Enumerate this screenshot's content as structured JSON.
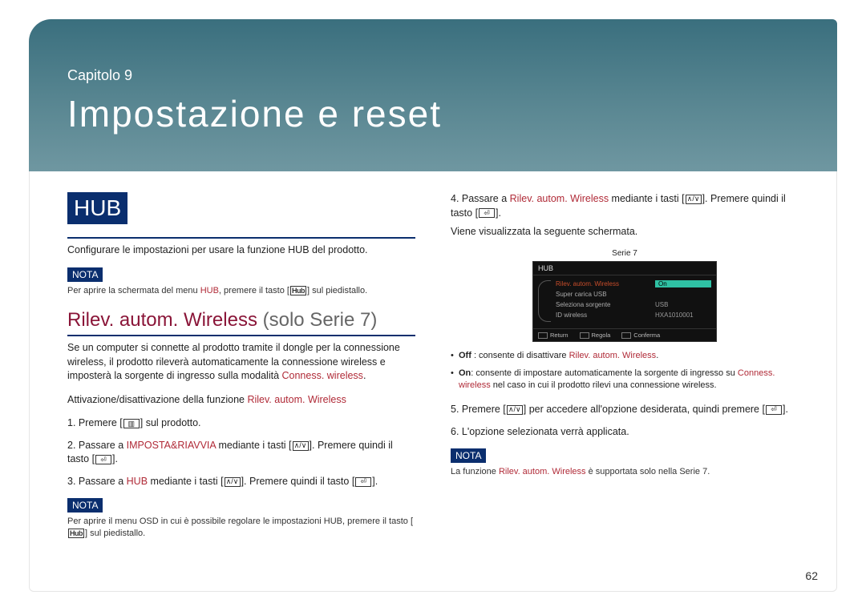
{
  "header": {
    "chapter": "Capitolo 9",
    "title": "Impostazione e reset"
  },
  "hub": {
    "pill": "HUB",
    "intro": "Configurare le impostazioni per usare la funzione HUB del prodotto.",
    "nota_label": "NOTA",
    "nota_text_prefix": "Per aprire la schermata del menu ",
    "nota_text_hub": "HUB",
    "nota_text_mid": ", premere il tasto [",
    "nota_text_suffix": "] sul piedistallo."
  },
  "section": {
    "title_main": "Rilev. autom. Wireless",
    "title_gray": " (solo Serie 7)",
    "para_a": "Se un computer si connette al prodotto tramite il dongle per la connessione wireless, il prodotto rileverà automaticamente la connessione wireless e imposterà la sorgente di ingresso sulla modalità ",
    "para_a_red": "Conness. wireless",
    "para_a_end": ".",
    "toggle_prefix": "Attivazione/disattivazione della funzione ",
    "toggle_red": "Rilev. autom. Wireless",
    "steps": {
      "s1_a": "1.  Premere [",
      "s1_b": "] sul prodotto.",
      "s2_a": "2.  Passare a ",
      "s2_red": "IMPOSTA&RIAVVIA",
      "s2_b": " mediante i tasti [",
      "s2_c": "]. Premere quindi il tasto [",
      "s2_d": "].",
      "s3_a": "3.  Passare a ",
      "s3_red": "HUB",
      "s3_b": " mediante i tasti [",
      "s3_c": "]. Premere quindi il tasto [",
      "s3_d": "]."
    },
    "nota2_label": "NOTA",
    "nota2_a": "Per aprire il menu OSD in cui è possibile regolare le impostazioni HUB, premere il tasto [",
    "nota2_b": "] sul piedistallo."
  },
  "right": {
    "s4_a": "4.  Passare a ",
    "s4_red": "Rilev. autom. Wireless",
    "s4_b": " mediante i tasti [",
    "s4_c": "]. Premere quindi il tasto [",
    "s4_d": "].",
    "s4_e": "Viene visualizzata la seguente schermata.",
    "preview_label": "Serie 7",
    "preview": {
      "title": "HUB",
      "rows": [
        {
          "k": "Rilev. autom. Wireless",
          "v": "On",
          "selected": true
        },
        {
          "k": "Super carica USB",
          "v": ""
        },
        {
          "k": "Seleziona sorgente",
          "v": "USB"
        },
        {
          "k": "ID wireless",
          "v": "HXA1010001"
        }
      ],
      "footer": {
        "a": "Return",
        "b": "Regola",
        "c": "Conferma"
      }
    },
    "bullets": {
      "off_a": "Off",
      "off_b": " : consente di disattivare ",
      "off_red": "Rilev. autom. Wireless",
      "off_c": ".",
      "on_a": "On",
      "on_b": ": consente di impostare automaticamente la sorgente di ingresso su ",
      "on_red": "Conness. wireless",
      "on_c": " nel caso in cui il prodotto rilevi una connessione wireless."
    },
    "s5_a": "5.  Premere [",
    "s5_b": "] per accedere all'opzione desiderata, quindi premere [",
    "s5_c": "].",
    "s6": "6.  L'opzione selezionata verrà applicata.",
    "nota_label": "NOTA",
    "nota_a": "La funzione ",
    "nota_red": "Rilev. autom. Wireless",
    "nota_b": " è supportata solo nella Serie 7."
  },
  "page_number": "62"
}
